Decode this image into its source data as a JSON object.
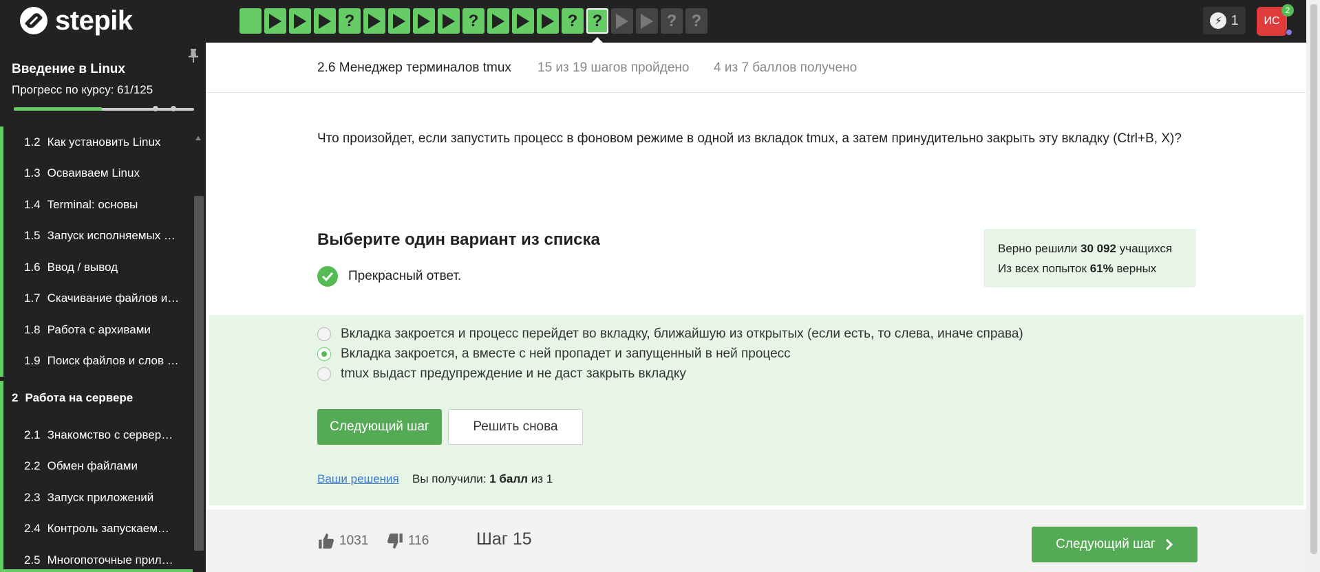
{
  "brand": {
    "name": "stepik"
  },
  "steps_nav": [
    {
      "state": "done",
      "icon": "blank"
    },
    {
      "state": "done",
      "icon": "play"
    },
    {
      "state": "done",
      "icon": "play"
    },
    {
      "state": "done",
      "icon": "play"
    },
    {
      "state": "done",
      "icon": "question"
    },
    {
      "state": "done",
      "icon": "play"
    },
    {
      "state": "done",
      "icon": "play"
    },
    {
      "state": "done",
      "icon": "play"
    },
    {
      "state": "done",
      "icon": "play"
    },
    {
      "state": "done",
      "icon": "question"
    },
    {
      "state": "done",
      "icon": "play"
    },
    {
      "state": "done",
      "icon": "play"
    },
    {
      "state": "done",
      "icon": "play"
    },
    {
      "state": "done",
      "icon": "question"
    },
    {
      "state": "current",
      "icon": "question"
    },
    {
      "state": "todo",
      "icon": "play"
    },
    {
      "state": "todo",
      "icon": "play"
    },
    {
      "state": "todo",
      "icon": "question"
    },
    {
      "state": "todo",
      "icon": "question"
    }
  ],
  "header": {
    "energy_count": "1",
    "avatar_initials": "ИС",
    "notifications": "2"
  },
  "sidebar": {
    "course_title": "Введение в Linux",
    "progress_text": "Прогресс по курсу:  61/125",
    "progress_fraction": 0.49,
    "items_top": [
      {
        "num": "1.2",
        "label": "Как установить Linux"
      },
      {
        "num": "1.3",
        "label": "Осваиваем Linux"
      },
      {
        "num": "1.4",
        "label": "Terminal: основы"
      },
      {
        "num": "1.5",
        "label": "Запуск исполняемых …"
      },
      {
        "num": "1.6",
        "label": "Ввод / вывод"
      },
      {
        "num": "1.7",
        "label": "Скачивание файлов и…"
      },
      {
        "num": "1.8",
        "label": "Работа с архивами"
      },
      {
        "num": "1.9",
        "label": "Поиск файлов и слов …"
      }
    ],
    "section": {
      "num": "2",
      "label": "Работа на сервере"
    },
    "items_bottom": [
      {
        "num": "2.1",
        "label": "Знакомство с сервер…"
      },
      {
        "num": "2.2",
        "label": "Обмен файлами"
      },
      {
        "num": "2.3",
        "label": "Запуск приложений"
      },
      {
        "num": "2.4",
        "label": "Контроль запускаем…"
      },
      {
        "num": "2.5",
        "label": "Многопоточные прил…"
      }
    ]
  },
  "lesson": {
    "title": "2.6 Менеджер терминалов tmux",
    "steps_done": "15 из 19 шагов пройдено",
    "points": "4 из 7 баллов  получено"
  },
  "question": {
    "text": "Что произойдет, если запустить процесс в фоновом режиме в одной из вкладок tmux, а затем принудительно закрыть эту вкладку (Ctrl+B, X)?",
    "choose_title": "Выберите один вариант из списка",
    "feedback": "Прекрасный ответ."
  },
  "stats": {
    "line1_prefix": "Верно решили",
    "line1_value": "30 092",
    "line1_suffix": "учащихся",
    "line2_prefix": "Из всех попыток",
    "line2_value": "61%",
    "line2_suffix": "верных"
  },
  "options": [
    {
      "label": "Вкладка закроется и процесс перейдет во вкладку, ближайшую из открытых (если есть, то слева, иначе справа)",
      "checked": false
    },
    {
      "label": "Вкладка закроется, а вместе с ней пропадет и запущенный в ней процесс",
      "checked": true
    },
    {
      "label": "tmux выдаст предупреждение и не даст закрыть вкладку",
      "checked": false
    }
  ],
  "actions": {
    "next_label": "Следующий шаг",
    "retry_label": "Решить снова",
    "solutions_link": "Ваши решения",
    "score_prefix": "Вы получили:",
    "score_value": "1 балл",
    "score_mid": "из",
    "score_total": "1"
  },
  "footer": {
    "likes": "1031",
    "dislikes": "116",
    "step_label": "Шаг 15",
    "next_label": "Следующий шаг"
  },
  "colors": {
    "accent_green": "#66cc66",
    "button_green": "#55aa55",
    "panel_green": "#e6f5e6",
    "topbar": "#222222",
    "avatar_red": "#e03c3c",
    "link_blue": "#3a7bd5"
  }
}
